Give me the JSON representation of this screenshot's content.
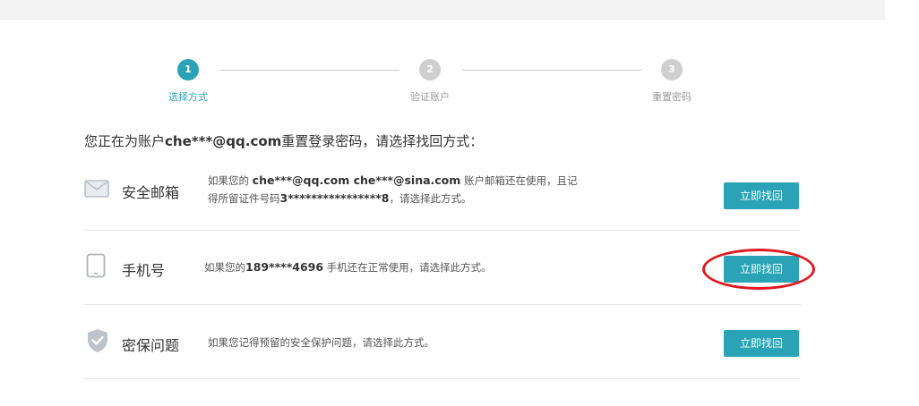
{
  "steps": [
    {
      "number": "1",
      "label": "选择方式"
    },
    {
      "number": "2",
      "label": "验证账户"
    },
    {
      "number": "3",
      "label": "重置密码"
    }
  ],
  "intro": {
    "prefix": "您正在为账户",
    "account": "che***@qq.com",
    "suffix": "重置登录密码，请选择找回方式："
  },
  "methods": {
    "email": {
      "title": "安全邮箱",
      "desc_1": "如果您的 ",
      "emails": "che***@qq.com  che***@sina.com",
      "desc_2": " 账户邮箱还在使用，且记",
      "desc_3": "得所留证件号码",
      "id_number": "3****************8",
      "desc_4": "，请选择此方式。",
      "button": "立即找回"
    },
    "phone": {
      "title": "手机号",
      "desc_1": "如果您的",
      "number": "189****4696",
      "desc_2": " 手机还在正常使用，请选择此方式。",
      "button": "立即找回"
    },
    "security": {
      "title": "密保问题",
      "desc": "如果您记得预留的安全保护问题，请选择此方式。",
      "button": "立即找回"
    }
  },
  "colors": {
    "accent": "#29a3b5",
    "highlight_ring": "#e0191f",
    "inactive": "#cfcfcf"
  }
}
